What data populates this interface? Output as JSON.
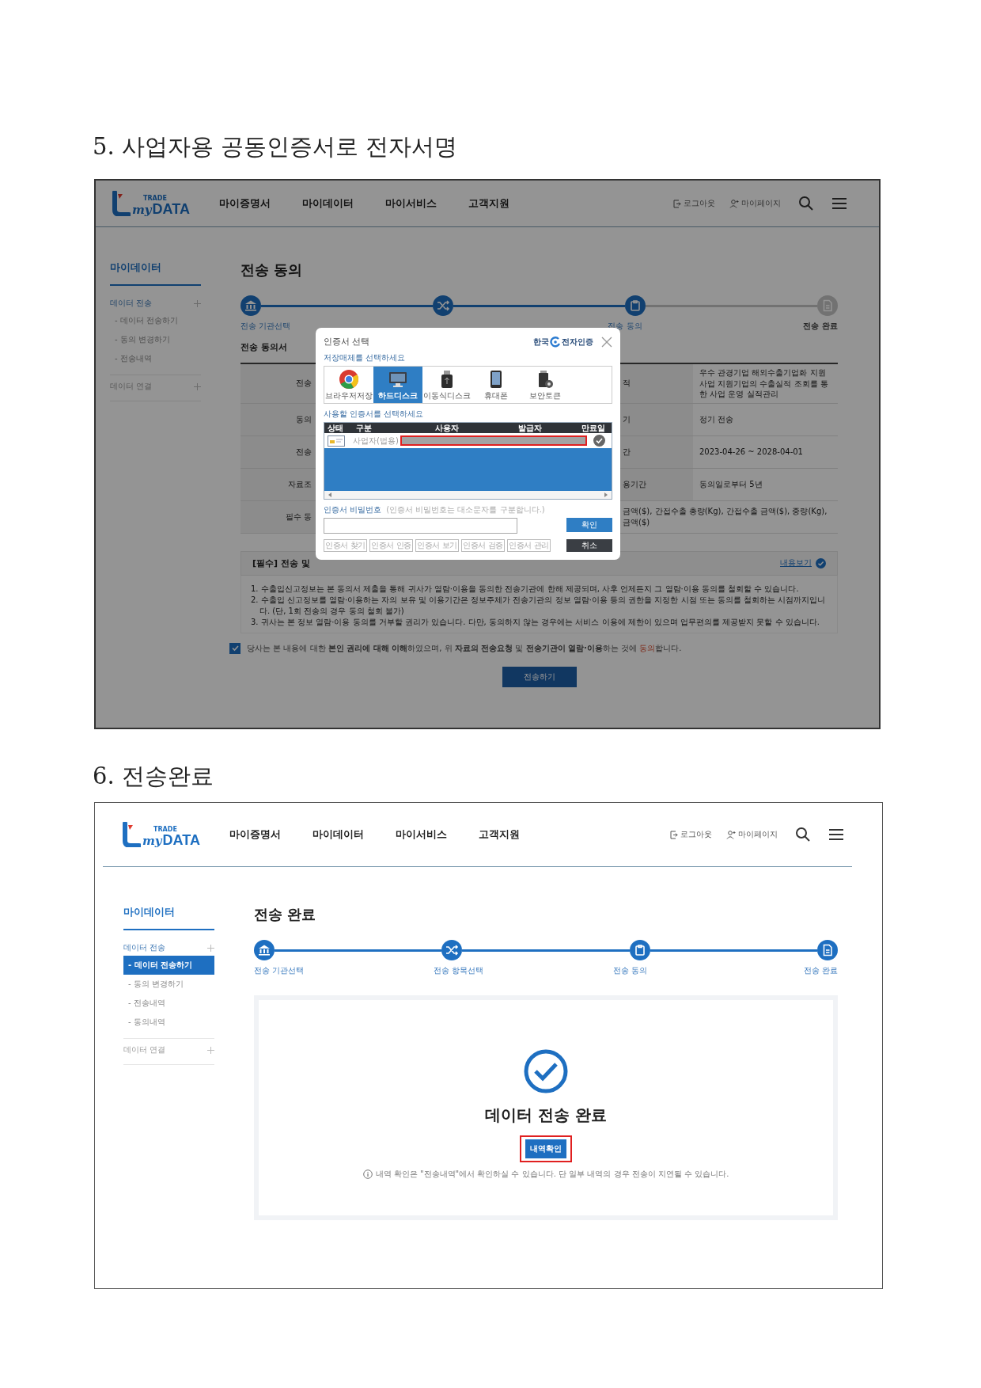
{
  "sections": [
    {
      "kind": "signing",
      "heading": "5. 사업자용 공동인증서로 전자서명",
      "screen": {
        "dimmed": true,
        "logo": {
          "top": "TRADE",
          "script": "my",
          "main": "DATA"
        },
        "nav": [
          "마이증명서",
          "마이데이터",
          "마이서비스",
          "고객지원"
        ],
        "user_links": [
          {
            "kind": "logout",
            "label": "로그아웃"
          },
          {
            "kind": "mypage",
            "label": "마이페이지"
          }
        ],
        "sidebar": {
          "title": "마이데이터",
          "groups": [
            {
              "label": "데이터 전송",
              "expanded": true,
              "children": [
                {
                  "label": "- 데이터 전송하기",
                  "selected": false
                },
                {
                  "label": "- 동의 변경하기",
                  "selected": false
                },
                {
                  "label": "- 전송내역",
                  "selected": false
                }
              ]
            },
            {
              "label": "데이터 연결",
              "expanded": false
            }
          ]
        },
        "page_title": "전송 동의",
        "steps": [
          {
            "label": "전송 기관선택",
            "done": true
          },
          {
            "done": true
          },
          {
            "label": "전송 동의",
            "done": true
          },
          {
            "label": "전송 완료",
            "done": false
          }
        ],
        "section_title": "전송 동의서",
        "table_rows": [
          {
            "label": "전송",
            "label_2": "적",
            "value_2": "우수 관경기업 해외수출기업화 지원 사업 지원기업의 수출실적 조회를 통한 사업 운영 실적관리"
          },
          {
            "label": "동의",
            "label_2": "기",
            "value_2": "정기 전송"
          },
          {
            "label": "전송",
            "label_2": "간",
            "value_2": "2023-04-26 ~ 2028-04-01"
          },
          {
            "label": "자료조",
            "label_2": "용기간",
            "value_2": "동의일로부터 5년"
          },
          {
            "label": "필수 동",
            "value_2": "금액($), 간접수출 총량(Kg), 간접수출 금액($), 중량(Kg), 금액($)"
          }
        ],
        "terms": {
          "title": "[필수] 전송 및",
          "link": "내용보기"
        },
        "terms_list": [
          "1. 수출입신고정보는 본 동의서 제출을 통해 귀사가 열람·이용을 동의한 전송기관에 한해 제공되며, 사후 언제든지 그 열람·이용 동의를 철회할 수 있습니다.",
          "2. 수출입 신고정보를 열람·이용하는 자의 보유 및 이용기간은 정보주체가 전송기관의 정보 열람·이용 등의 권한을 지정한 시점 또는 동의를 철회하는 시점까지입니다. (단, 1회 전송의 경우 동의 철회 불가)",
          "3. 귀사는 본 정보 열람·이용 동의를 거부할 권리가 있습니다. 다만, 동의하지 않는 경우에는 서비스 이용에 제한이 있으며 업무편의를 제공받지 못할 수 있습니다."
        ],
        "consent": {
          "checked": true,
          "text": "당사는 본 내용에 대한 **본인 권리에 대해 이해**하였으며, 위 **자료의 전송요청** 및 **전송기관이 열람·이용**하는 것에 ",
          "highlight": "동의",
          "end": "합니다."
        },
        "submit": "전송하기",
        "dialog": {
          "title": "인증서 선택",
          "brand_left": "한국",
          "brand_right": "전자인증",
          "media_prompt": "저장매체를 선택하세요",
          "media": [
            {
              "kind": "browser",
              "label": "브라우저저장",
              "selected": false
            },
            {
              "kind": "disk",
              "label": "하드디스크",
              "selected": true
            },
            {
              "kind": "usb",
              "label": "이동식디스크",
              "selected": false
            },
            {
              "kind": "phone",
              "label": "휴대폰",
              "selected": false
            },
            {
              "kind": "token",
              "label": "보안토큰",
              "selected": false
            }
          ],
          "cert_prompt": "사용할 인증서를 선택하세요",
          "columns": [
            "상태",
            "구분",
            "사용자",
            "발급자",
            "만료일"
          ],
          "cert_type": "사업자(법용)",
          "password_label": "인증서 비밀번호",
          "password_hint": "(인증서 비밀번호는 대소문자를 구분합니다.)",
          "confirm": "확인",
          "tools": [
            "인증서 찾기",
            "인증서 인증",
            "인증서 보기",
            "인증서 검증",
            "인증서 관리"
          ],
          "cancel": "취소"
        }
      }
    },
    {
      "kind": "complete",
      "heading": "6. 전송완료",
      "screen": {
        "logo": {
          "top": "TRADE",
          "script": "my",
          "main": "DATA"
        },
        "nav": [
          "마이증명서",
          "마이데이터",
          "마이서비스",
          "고객지원"
        ],
        "user_links": [
          {
            "kind": "logout",
            "label": "로그아웃"
          },
          {
            "kind": "mypage",
            "label": "마이페이지"
          }
        ],
        "sidebar": {
          "title": "마이데이터",
          "groups": [
            {
              "label": "데이터 전송",
              "expanded": true,
              "children": [
                {
                  "label": "- 데이터 전송하기",
                  "selected": true
                },
                {
                  "label": "- 동의 변경하기",
                  "selected": false
                },
                {
                  "label": "- 전송내역",
                  "selected": false
                },
                {
                  "label": "- 동의내역",
                  "selected": false
                }
              ]
            },
            {
              "label": "데이터 연결",
              "expanded": false
            }
          ]
        },
        "page_title": "전송 완료",
        "steps": [
          {
            "label": "전송 기관선택",
            "done": true
          },
          {
            "label": "전송 항목선택",
            "done": true
          },
          {
            "label": "전송 동의",
            "done": true
          },
          {
            "label": "전송 완료",
            "done": true
          }
        ],
        "result": {
          "title": "데이터 전송 완료",
          "button": "내역확인",
          "note": "내역 확인은 \"전송내역\"에서 확인하실 수 있습니다. 단 일부 내역의 경우 전송이 지연될 수 있습니다."
        }
      }
    }
  ]
}
